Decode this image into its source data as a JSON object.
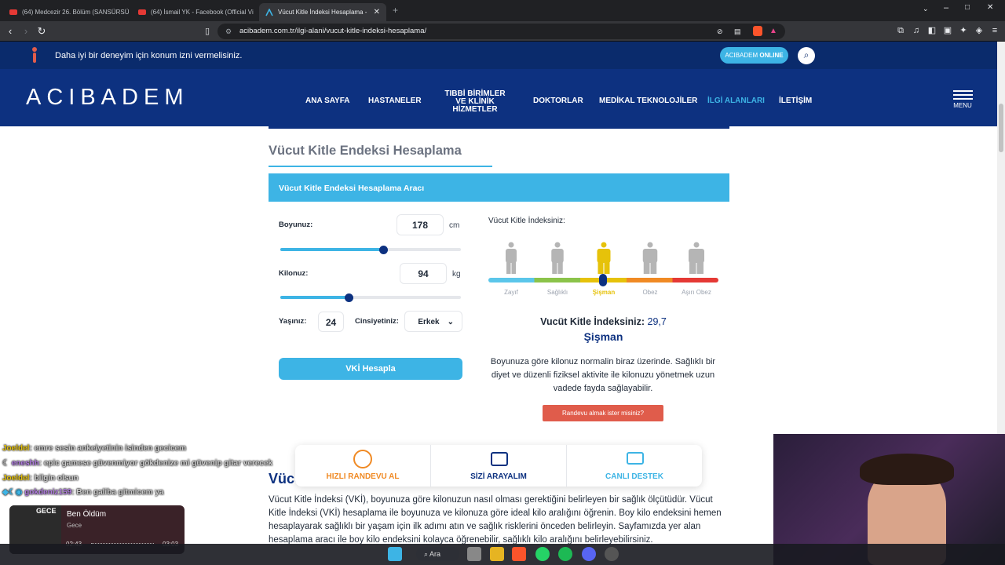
{
  "browser": {
    "tabs": [
      {
        "title": "(64) Medcezir 26. Bölüm (SANSÜRSÜ"
      },
      {
        "title": "(64) İsmail YK - Facebook (Official Vi"
      },
      {
        "title": "Vücut Kitle İndeksi Hesaplama - "
      }
    ],
    "url": "acibadem.com.tr/ilgi-alani/vucut-kitle-indeksi-hesaplama/"
  },
  "site": {
    "location_notice": "Daha iyi bir deneyim için konum izni vermelisiniz.",
    "online_button": {
      "brand": "ACIBADEM",
      "suffix": "ONLINE"
    },
    "logo": "ACIBADEM",
    "nav": [
      "ANA SAYFA",
      "HASTANELER",
      "TIBBİ BİRİMLER",
      "VE KLİNİK HİZMETLER",
      "DOKTORLAR",
      "MEDİKAL TEKNOLOJİLER",
      "İLGİ ALANLARI",
      "İLETİŞİM"
    ],
    "menu_label": "MENU"
  },
  "calculator": {
    "page_title": "Vücut Kitle Endeksi Hesaplama",
    "tool_header": "Vücut Kitle Endeksi Hesaplama Aracı",
    "height_label": "Boyunuz:",
    "height_value": "178",
    "height_unit": "cm",
    "height_slider_fraction": 0.57,
    "weight_label": "Kilonuz:",
    "weight_value": "94",
    "weight_unit": "kg",
    "weight_slider_fraction": 0.38,
    "age_label": "Yaşınız:",
    "age_value": "24",
    "gender_label": "Cinsiyetiniz:",
    "gender_value": "Erkek",
    "button": "VKİ Hesapla",
    "result_heading": "Vücut Kitle İndeksiniz:",
    "categories": [
      "Zayıf",
      "Sağlıklı",
      "Şişman",
      "Obez",
      "Aşırı Obez"
    ],
    "result_line": "Vucüt Kitle İndeksiniz:",
    "result_value": "29,7",
    "result_category": "Şişman",
    "description": "Boyunuza göre kilonuz normalin biraz üzerinde. Sağlıklı bir diyet ve düzenli fiziksel aktivite ile kilonuzu yönetmek uzun vadede fayda sağlayabilir.",
    "appointment_button": "Randevu almak ister misiniz?",
    "colors": {
      "accent": "#3db4e5",
      "navy": "#0d3180",
      "highlight": "#e6c20a",
      "red": "#e05c4b"
    }
  },
  "float_bar": [
    "HIZLI RANDEVU AL",
    "SİZİ ARAYALIM",
    "CANLI DESTEK"
  ],
  "article": {
    "heading": "Vücu",
    "text": "Vücut Kitle İndeksi (VKİ), boyunuza göre kilonuzun nasıl olması gerektiğini belirleyen bir sağlık ölçütüdür. Vücut Kitle İndeksi (VKİ) hesaplama ile boyunuza ve kilonuza göre ideal kilo aralığını öğrenin. Boy kilo endeksini hemen hesaplayarak sağlıklı bir yaşam için ilk adımı atın ve sağlık risklerini önceden belirleyin. Sayfamızda yer alan hesaplama aracı ile boy kilo endeksini kolayca öğrenebilir, sağlıklı kilo aralığını belirleyebilirsiniz."
  },
  "chat": [
    {
      "user": "Joeldel",
      "msg": ": emre sesin ankeiyetinin isinden gecicem"
    },
    {
      "user": "eneshh",
      "msg": ": epic gamese güvenmiyor gökdenize mi güvenip gitar verecek"
    },
    {
      "user": "Joeldel",
      "msg": ": bilgin olsun"
    },
    {
      "user": "gokdeniz159",
      "msg": ": Ben galiba gitmicem ya"
    }
  ],
  "music": {
    "album": "GECE",
    "title": "Ben Öldüm",
    "artist": "Gece",
    "elapsed": "02:43",
    "total": "03:03"
  },
  "taskbar": {
    "search": "Ara"
  }
}
